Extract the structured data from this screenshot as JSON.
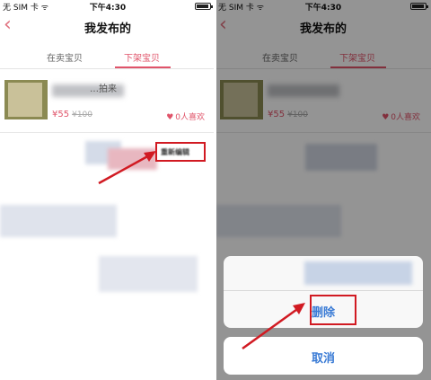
{
  "status_bar": {
    "carrier": "无 SIM 卡 ᯤ",
    "time": "下午4:30"
  },
  "navbar": {
    "back_icon": "chevron-left-icon",
    "title": "我发布的"
  },
  "tabs": [
    {
      "label": "在卖宝贝",
      "active": false
    },
    {
      "label": "下架宝贝",
      "active": true
    }
  ],
  "item": {
    "title": "…拍来",
    "price": "¥55",
    "old_price": "¥100",
    "likes": "0人喜欢"
  },
  "right_item": {
    "price": "¥55",
    "old_price": "¥100",
    "likes": "0人喜欢"
  },
  "edit_button": {
    "label": "重新编辑"
  },
  "action_sheet": {
    "delete_label": "删除",
    "cancel_label": "取消"
  },
  "colors": {
    "accent": "#e0546a",
    "highlight_box": "#d11a22",
    "action_blue": "#3a7bd5"
  }
}
